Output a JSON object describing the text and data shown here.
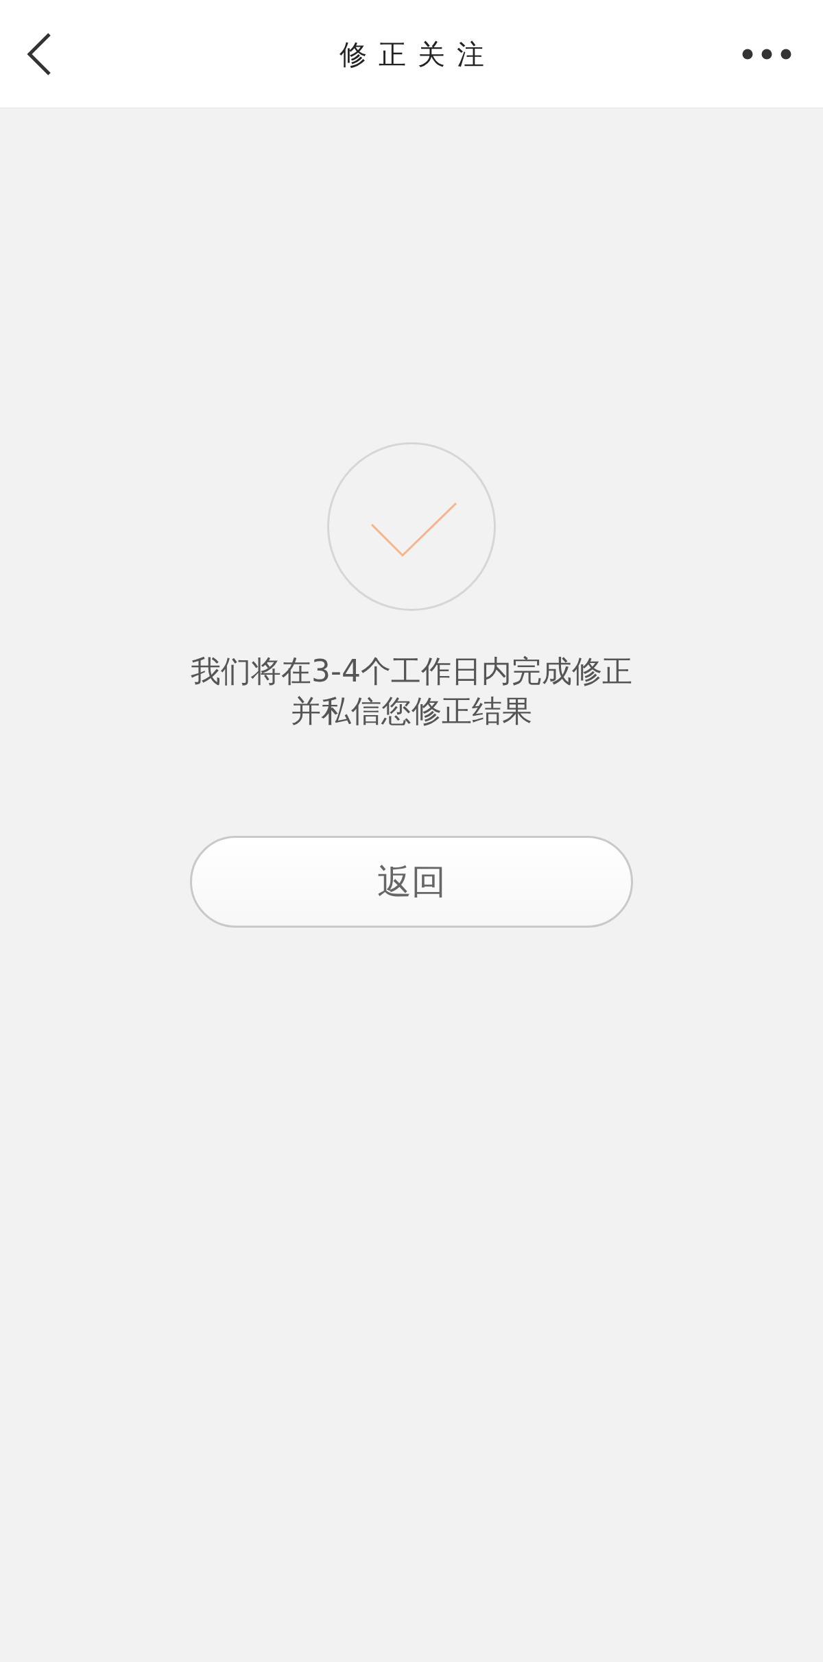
{
  "header": {
    "title": "修正关注"
  },
  "result": {
    "kind": "success",
    "message": "我们将在3-4个工作日内完成修正并私信您修正结果"
  },
  "buttons": [
    {
      "label": "返回"
    }
  ]
}
